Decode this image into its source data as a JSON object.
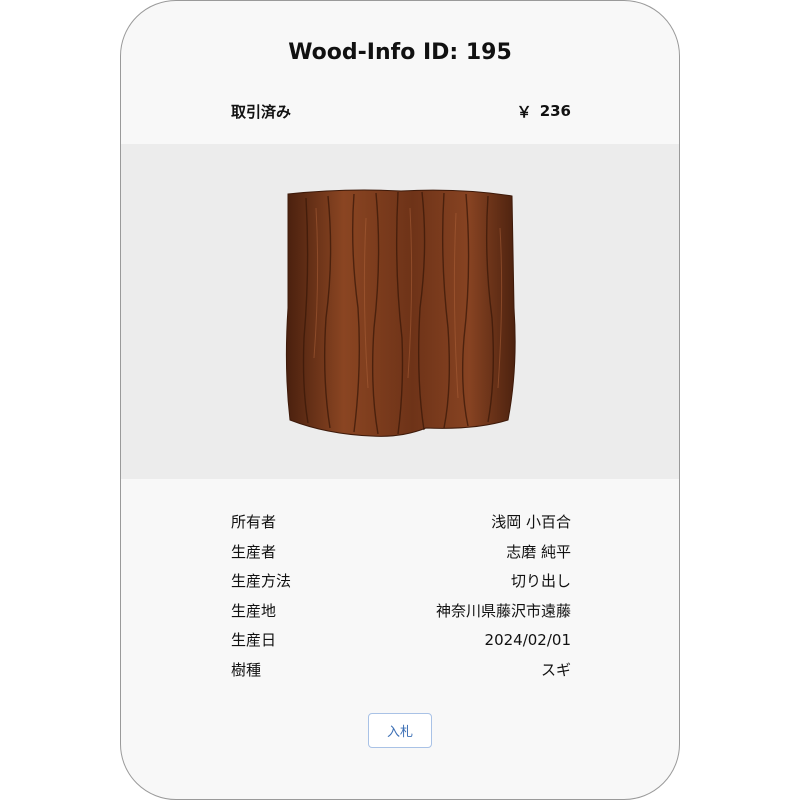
{
  "card": {
    "title": "Wood-Info ID: 195",
    "status": "取引済み",
    "currency_symbol": "￥",
    "price": "236"
  },
  "image": {
    "icon": "wood-log-image",
    "colors": {
      "background": "#ececec",
      "bark_dark": "#5a2a12",
      "bark_mid": "#7a3a1c",
      "bark_light": "#9a4f2a"
    }
  },
  "details": [
    {
      "label": "所有者",
      "value": "浅岡 小百合"
    },
    {
      "label": "生産者",
      "value": "志磨 純平"
    },
    {
      "label": "生産方法",
      "value": "切り出し"
    },
    {
      "label": "生産地",
      "value": "神奈川県藤沢市遠藤"
    },
    {
      "label": "生産日",
      "value": "2024/02/01"
    },
    {
      "label": "樹種",
      "value": "スギ"
    }
  ],
  "actions": {
    "bid_label": "入札"
  }
}
